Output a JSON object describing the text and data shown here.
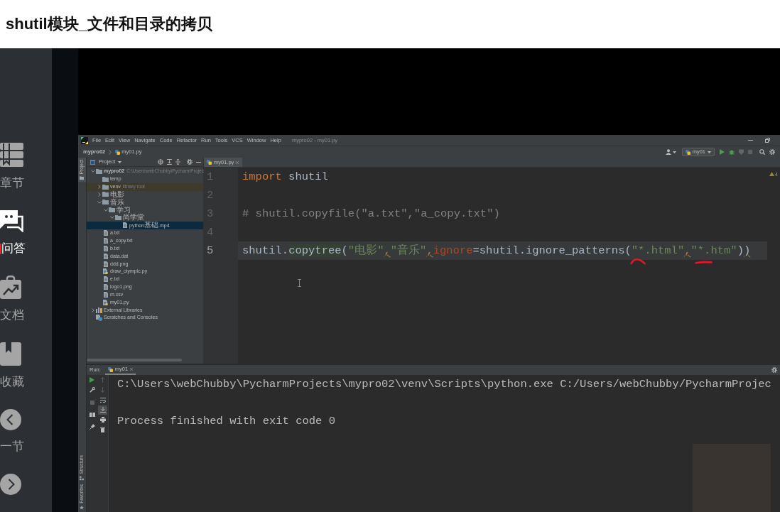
{
  "page": {
    "title": "shutil模块_文件和目录的拷贝"
  },
  "sidebar": {
    "items": [
      {
        "kind": "chapters",
        "label": "章节",
        "selected": false
      },
      {
        "kind": "qa",
        "label": "问答",
        "selected": true
      },
      {
        "kind": "docs",
        "label": "文档",
        "selected": false
      },
      {
        "kind": "favorites",
        "label": "收藏",
        "selected": false
      },
      {
        "kind": "previous",
        "label": "一节",
        "selected": false
      },
      {
        "kind": "next",
        "selected": false
      }
    ]
  },
  "ide": {
    "menu": [
      "File",
      "Edit",
      "View",
      "Navigate",
      "Code",
      "Refactor",
      "Run",
      "Tools",
      "VCS",
      "Window",
      "Help"
    ],
    "window_title": "mypro02 - my01.py",
    "breadcrumbs": [
      {
        "label": "mypro02",
        "kind": "project"
      },
      {
        "label": "my01.py",
        "kind": "python-file"
      }
    ],
    "run_config": "my01",
    "tool_strip": [
      {
        "kind": "project",
        "label": "Project",
        "selected": true
      },
      {
        "kind": "structure",
        "label": "Structure",
        "selected": false
      },
      {
        "kind": "favorites",
        "label": "Favorites",
        "selected": false
      }
    ],
    "project": {
      "title": "Project",
      "tree": [
        {
          "name": "mypro02",
          "kind": "project-folder",
          "note": "C:\\Users\\webChubby\\PycharmProjec",
          "expanded": true,
          "selected": false,
          "children": [
            {
              "name": "temp",
              "kind": "folder",
              "selected": false
            },
            {
              "name": "venv",
              "kind": "library-folder",
              "note": "library root",
              "expanded": false,
              "selected": false
            },
            {
              "name": "电影",
              "kind": "folder",
              "expanded": false,
              "selected": false
            },
            {
              "name": "音乐",
              "kind": "folder",
              "expanded": true,
              "selected": false,
              "children": [
                {
                  "name": "学习",
                  "kind": "folder",
                  "expanded": true,
                  "selected": false,
                  "children": [
                    {
                      "name": "尚学堂",
                      "kind": "folder",
                      "expanded": true,
                      "selected": false,
                      "children": [
                        {
                          "name": "python基础.mp4",
                          "kind": "file",
                          "selected": true
                        }
                      ]
                    }
                  ]
                }
              ]
            },
            {
              "name": "a.txt",
              "kind": "file",
              "selected": false
            },
            {
              "name": "a_copy.txt",
              "kind": "file",
              "selected": false
            },
            {
              "name": "b.txt",
              "kind": "file",
              "selected": false
            },
            {
              "name": "data.dat",
              "kind": "file",
              "selected": false
            },
            {
              "name": "ddd.png",
              "kind": "file",
              "selected": false
            },
            {
              "name": "draw_olympic.py",
              "kind": "python-file",
              "selected": false
            },
            {
              "name": "e.txt",
              "kind": "file",
              "selected": false
            },
            {
              "name": "logo1.png",
              "kind": "file",
              "selected": false
            },
            {
              "name": "m.csv",
              "kind": "file",
              "selected": false
            },
            {
              "name": "my01.py",
              "kind": "python-file",
              "selected": false
            }
          ]
        },
        {
          "name": "External Libraries",
          "kind": "libraries",
          "expanded": false,
          "selected": false
        },
        {
          "name": "Scratches and Consoles",
          "kind": "scratches",
          "selected": false
        }
      ]
    },
    "editor": {
      "tabs": [
        {
          "label": "my01.py",
          "selected": true
        }
      ],
      "warnings": "4",
      "lines": [
        {
          "number": "1",
          "current": false,
          "tokens": [
            {
              "text": "import",
              "kind": "keyword"
            },
            {
              "text": " shutil",
              "kind": "plain"
            }
          ]
        },
        {
          "number": "2",
          "current": false
        },
        {
          "number": "3",
          "current": false,
          "tokens": [
            {
              "text": "# shutil.copyfile(\"a.txt\",\"a_copy.txt\")",
              "kind": "comment"
            }
          ]
        },
        {
          "number": "4",
          "current": false
        },
        {
          "number": "5",
          "current": true,
          "tokens": [
            {
              "text": "shutil.",
              "kind": "plain"
            },
            {
              "text": "copytree",
              "kind": "usage"
            },
            {
              "text": "(",
              "kind": "plain"
            },
            {
              "text": "\"电影\"",
              "kind": "string"
            },
            {
              "text": ",",
              "kind": "comma-warning"
            },
            {
              "text": "\"音乐\"",
              "kind": "string"
            },
            {
              "text": ",",
              "kind": "comma-warning"
            },
            {
              "text": "ignore",
              "kind": "param"
            },
            {
              "text": "=shutil.ignore_patterns(",
              "kind": "plain"
            },
            {
              "text": "\"*.html\"",
              "kind": "string"
            },
            {
              "text": ",",
              "kind": "comma-warning"
            },
            {
              "text": "\"*.htm\"",
              "kind": "string"
            },
            {
              "text": ")",
              "kind": "plain"
            },
            {
              "text": ")",
              "kind": "warning"
            }
          ]
        }
      ]
    },
    "run": {
      "title": "Run:",
      "tabs": [
        {
          "label": "my01",
          "selected": true
        }
      ],
      "scroll_to_end": true,
      "console": [
        "C:\\Users\\webChubby\\PycharmProjects\\mypro02\\venv\\Scripts\\python.exe C:/Users/webChubby/PycharmProjec",
        "Process finished with exit code 0"
      ]
    }
  }
}
